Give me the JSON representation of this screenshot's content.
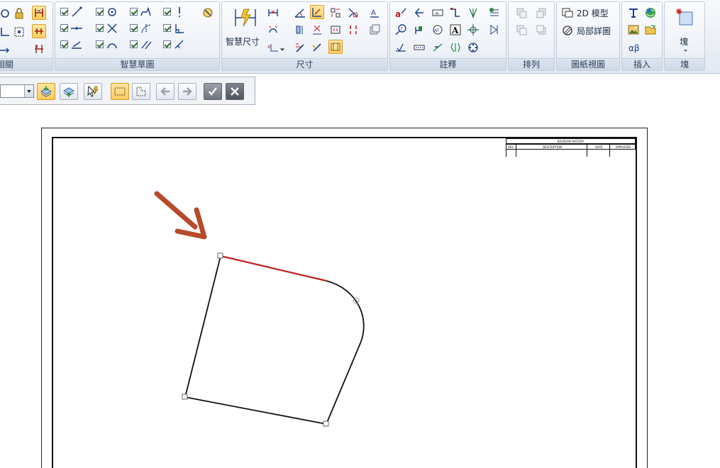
{
  "ribbon": {
    "groups": {
      "relations_label": "相關",
      "sketch_label": "智慧草圖",
      "dimension_label": "尺寸",
      "annotation_label": "註釋",
      "arrange_label": "排列",
      "drawing_views_label": "圖紙視圖",
      "insert_label": "插入",
      "block_label": "塊"
    },
    "smart_dimension_label": "智慧尺寸",
    "model_2d_label": "2D 模型",
    "detail_view_label": "局部詳圖",
    "block_button_label": "塊"
  },
  "revision_table": {
    "title": "REVISION HISTORY",
    "columns": [
      "REV",
      "DESCRIPTION",
      "DATE",
      "APPROVED"
    ]
  },
  "colors": {
    "selected_edge": "#c0201e",
    "arrow": "#b84a2a",
    "outline": "#111111"
  }
}
